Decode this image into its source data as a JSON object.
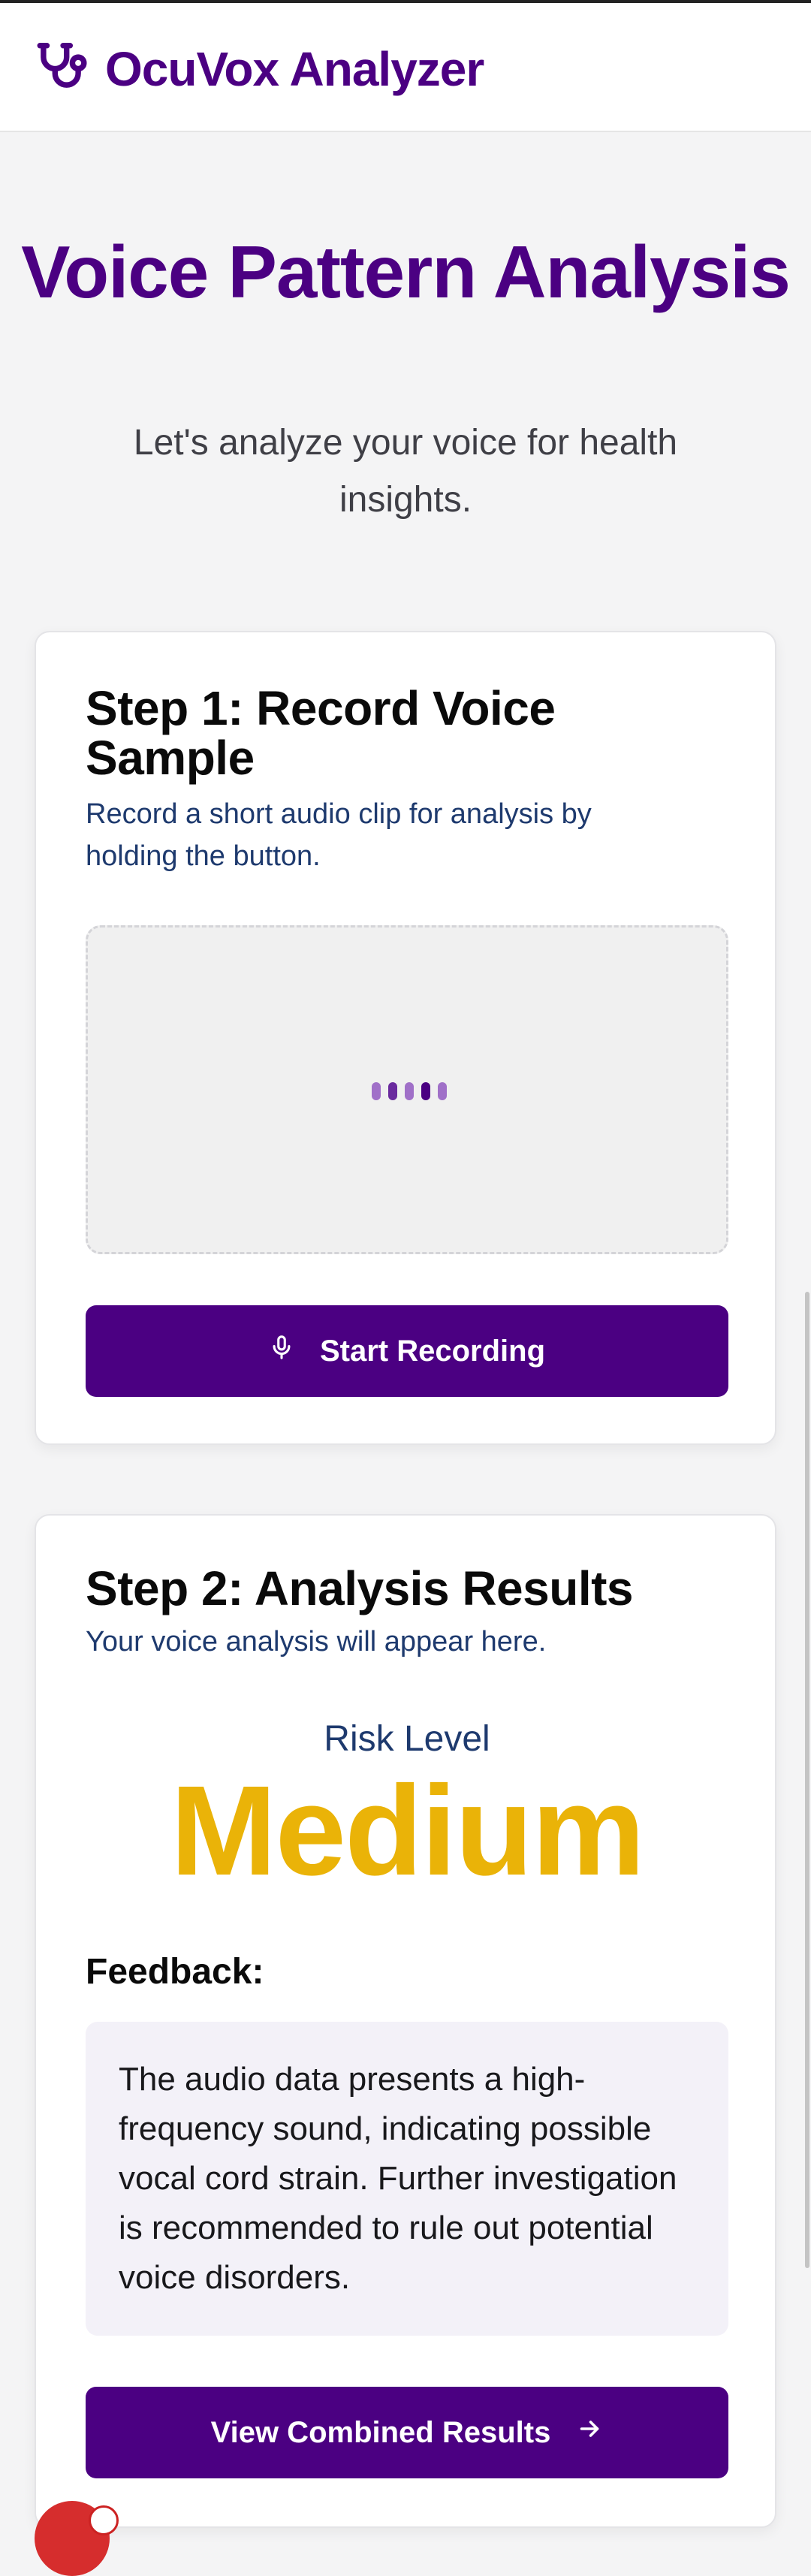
{
  "app": {
    "name": "OcuVox Analyzer",
    "logo_icon": "stethoscope-icon",
    "brand_color": "#4b0082"
  },
  "hero": {
    "title": "Voice Pattern Analysis",
    "subtitle": "Let's analyze your voice for health insights."
  },
  "step1": {
    "title": "Step 1: Record Voice Sample",
    "description": "Record a short audio clip for analysis by holding the button.",
    "button_label": "Start Recording",
    "button_icon": "microphone-icon"
  },
  "step2": {
    "title": "Step 2: Analysis Results",
    "description": "Your voice analysis will appear here.",
    "risk_label": "Risk Level",
    "risk_value": "Medium",
    "risk_color": "#eab308",
    "feedback_heading": "Feedback:",
    "feedback_text": "The audio data presents a high-frequency sound, indicating possible vocal cord strain. Further investigation is recommended to rule out potential voice disorders.",
    "button_label": "View Combined Results",
    "button_icon": "arrow-right-icon"
  }
}
